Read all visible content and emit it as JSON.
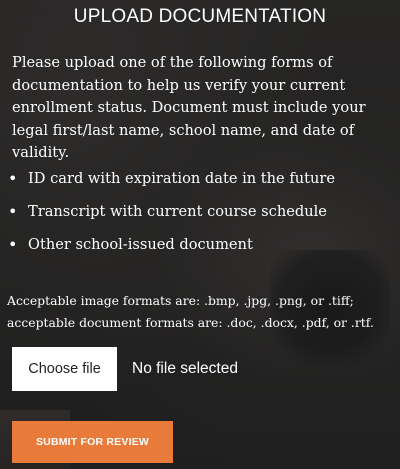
{
  "page": {
    "title": "UPLOAD DOCUMENTATION",
    "intro": "Please upload one of the following forms of documentation to help us verify your current enrollment status. Document must include your legal first/last name, school name, and date of validity.",
    "documents": [
      "ID card with expiration date in the future",
      "Transcript with current course schedule",
      "Other school-issued document"
    ],
    "bullet_char": "•",
    "formats_line_1": "Acceptable image formats are: .bmp, .jpg, .png, or .tiff;",
    "formats_line_2": "acceptable document formats are: .doc, .docx, .pdf, or .rtf."
  },
  "file_input": {
    "button_label": "Choose file",
    "status": "No file selected"
  },
  "submit": {
    "label": "SUBMIT FOR REVIEW"
  },
  "colors": {
    "accent": "#e87a3a",
    "overlay": "#1c1c1c",
    "text": "#ffffff"
  }
}
